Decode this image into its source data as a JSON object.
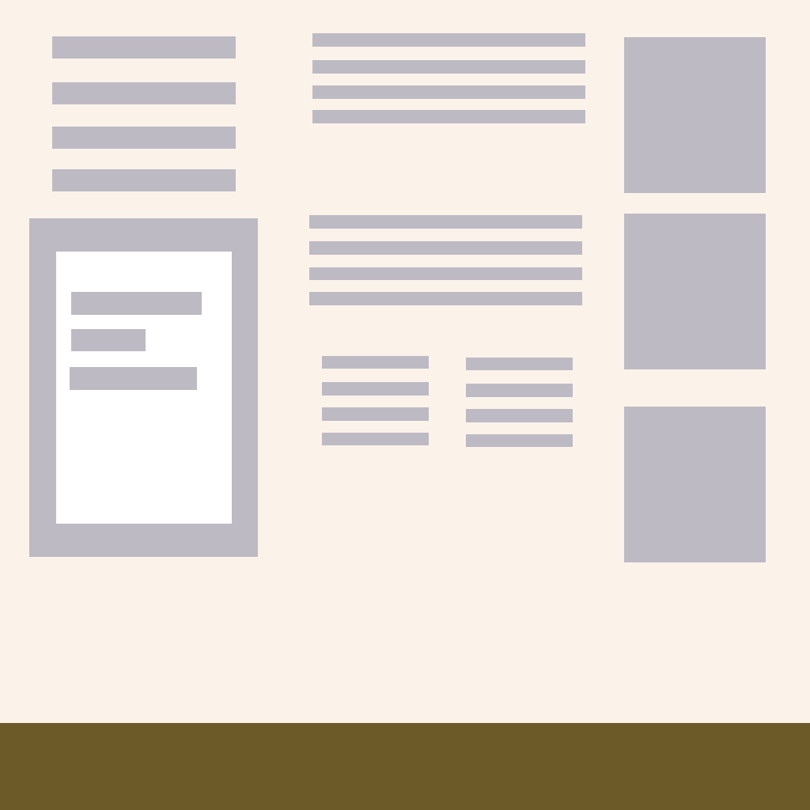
{
  "colors": {
    "background": "#fbf2ea",
    "placeholder": "#bdbac4",
    "panel_inner": "#ffffff",
    "footer": "#6d5a29"
  },
  "left_column": {
    "nav_bars": 4,
    "panel": {
      "text_bars": 3
    }
  },
  "center_column": {
    "text_block_1_bars": 4,
    "text_block_2_bars": 4,
    "list_left_bars": 4,
    "list_right_bars": 4
  },
  "right_column": {
    "image_blocks": 3
  }
}
